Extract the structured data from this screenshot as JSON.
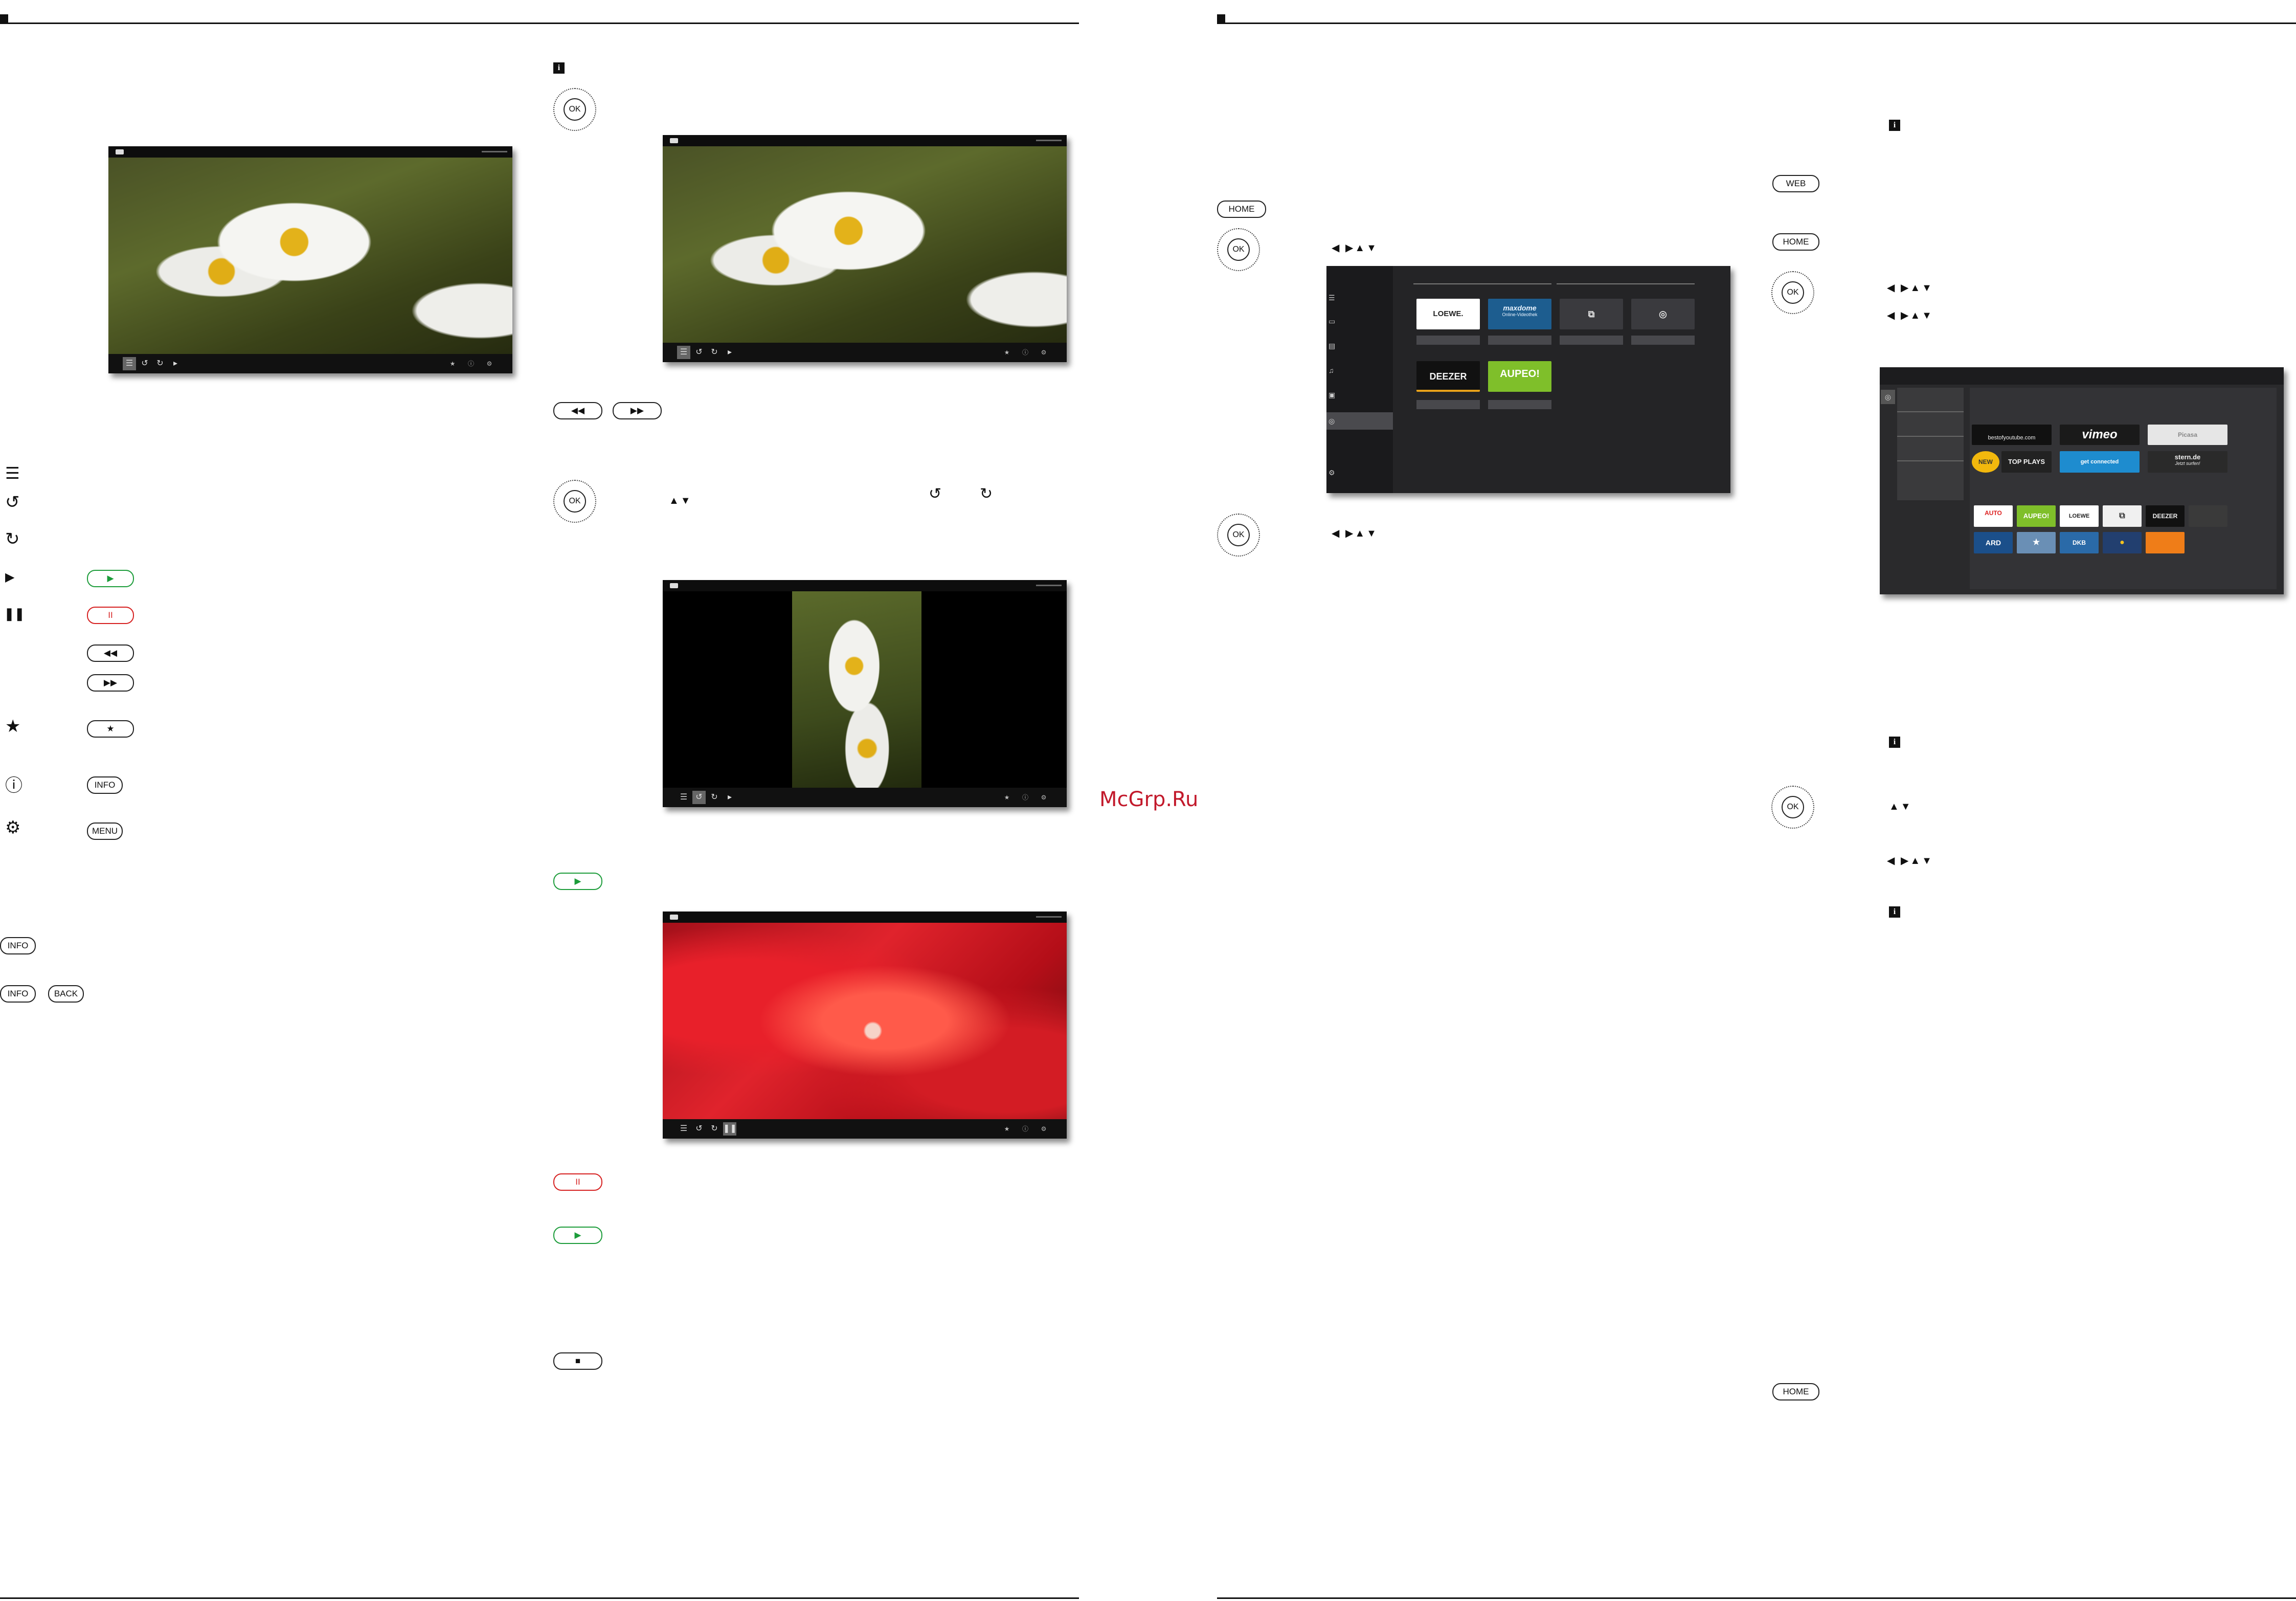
{
  "watermark": "McGrp.Ru",
  "keys": {
    "ok": "OK",
    "info": "INFO",
    "menu": "MENU",
    "back": "BACK",
    "home": "HOME",
    "web": "WEB",
    "info_symbol": "i",
    "play": "▶",
    "pause": "II",
    "rewind": "◀◀",
    "forward": "▶▶",
    "favourite": "★",
    "stop": "■"
  },
  "media_portal": {
    "tiles": [
      "LOEWE.",
      "maxdome",
      "",
      "",
      "DEEZER",
      "AUPEO!"
    ],
    "maxdome_sub": "Online-Videothek"
  },
  "web_portal": {
    "tiles_top": [
      "bestofyoutube.com",
      "vimeo",
      "Picasa",
      "NEW",
      "TOP PLAYS",
      "get connected",
      "stern.de"
    ],
    "stern_sub": "Jetzt surfen!",
    "tiles_bottom": [
      "AUTO",
      "AUPEO!",
      "LOEWE",
      "",
      "DEEZER",
      "",
      "ARD",
      "",
      "DKB",
      "",
      ""
    ]
  },
  "icons": {
    "list": "list-icon",
    "rotate_left": "rotate-left-icon",
    "rotate_right": "rotate-right-icon",
    "play": "play-icon",
    "pause": "pause-icon",
    "favourite": "star-icon",
    "info": "info-icon",
    "settings": "gear-icon",
    "camera": "camera-icon"
  },
  "colors": {
    "play_key": "#1c9c3a",
    "pause_key": "#d62020",
    "watermark": "#c2192b"
  }
}
